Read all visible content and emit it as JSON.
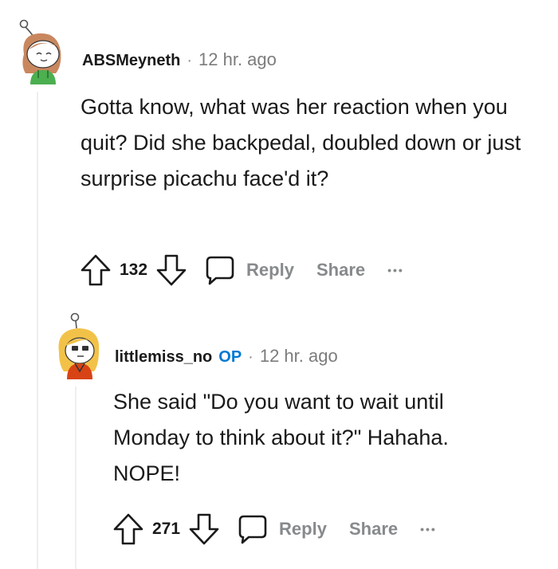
{
  "comments": [
    {
      "username": "ABSMeyneth",
      "separator": "·",
      "time": "12 hr. ago",
      "body": "Gotta know, what was her reaction when you quit? Did she backpedal, doubled down or just surprise picachu face'd it?",
      "score": "132",
      "reply_label": "Reply",
      "share_label": "Share",
      "more_label": "•••",
      "avatar_icon": "snoo-avatar-green-icon"
    },
    {
      "username": "littlemiss_no",
      "op_badge": "OP",
      "separator": "·",
      "time": "12 hr. ago",
      "body_lines": [
        "She said \"Do you want to wait until",
        "Monday to think about it?\" Hahaha.",
        "NOPE!"
      ],
      "score": "271",
      "reply_label": "Reply",
      "share_label": "Share",
      "more_label": "•••",
      "avatar_icon": "snoo-avatar-orange-icon"
    }
  ],
  "colors": {
    "text": "#1a1a1b",
    "muted": "#878a8c",
    "op_blue": "#0079d3",
    "thread_line": "#edeff1"
  }
}
